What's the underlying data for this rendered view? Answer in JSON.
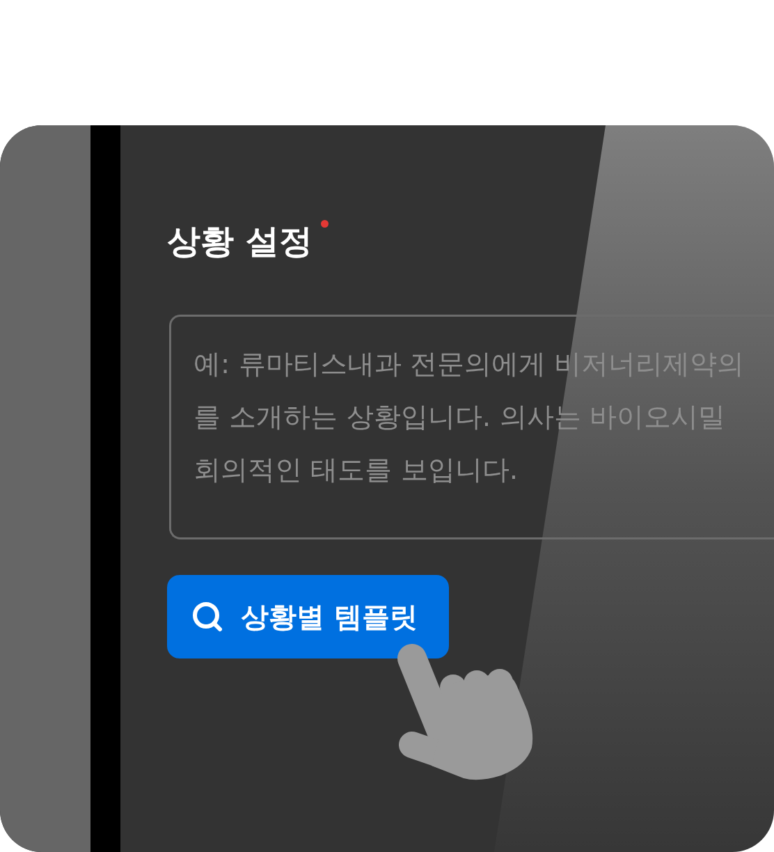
{
  "section": {
    "title": "상황 설정",
    "required": true
  },
  "situation_field": {
    "placeholder": "예: 류마티스내과 전문의에게 비저너리제약의\n를 소개하는 상황입니다. 의사는 바이오시밀\n회의적인 태도를 보입니다."
  },
  "template_button": {
    "label": "상황별 템플릿"
  }
}
